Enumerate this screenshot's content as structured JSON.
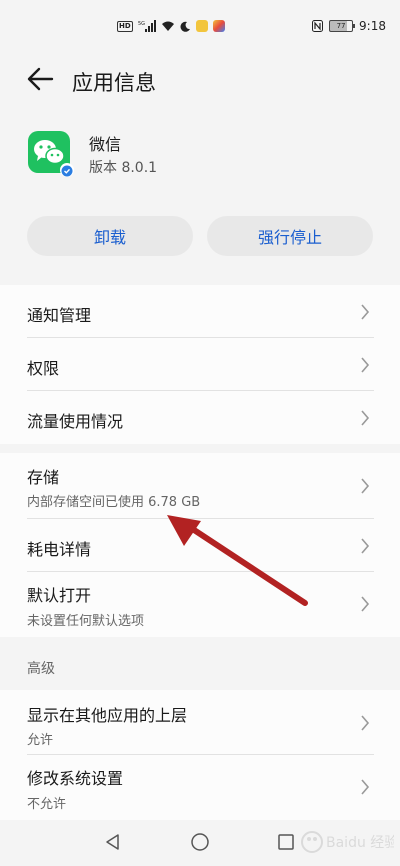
{
  "status_bar": {
    "network": "5G",
    "time": "9:18",
    "battery": "77",
    "battery_level": 0.77,
    "icons": [
      "hd-icon",
      "signal-icon",
      "wifi-icon",
      "moon-icon",
      "app-notification-icon",
      "app-notification-icon",
      "nfc-icon",
      "battery-icon"
    ]
  },
  "header": {
    "title": "应用信息"
  },
  "app": {
    "name": "微信",
    "version": "版本 8.0.1",
    "icon_color": "#1fc160"
  },
  "actions": {
    "uninstall": "卸载",
    "force_stop": "强行停止"
  },
  "settings_group1": [
    {
      "label": "通知管理"
    },
    {
      "label": "权限"
    },
    {
      "label": "流量使用情况"
    }
  ],
  "settings_group2": [
    {
      "label": "存储",
      "sub": "内部存储空间已使用 6.78 GB"
    },
    {
      "label": "耗电详情"
    },
    {
      "label": "默认打开",
      "sub": "未设置任何默认选项"
    }
  ],
  "advanced": {
    "heading": "高级",
    "items": [
      {
        "label": "显示在其他应用的上层",
        "sub": "允许"
      },
      {
        "label": "修改系统设置",
        "sub": "不允许"
      }
    ]
  },
  "colors": {
    "accent": "#1a5ecf",
    "annotation_arrow": "#b22222"
  },
  "watermark": "Baidu 经验"
}
